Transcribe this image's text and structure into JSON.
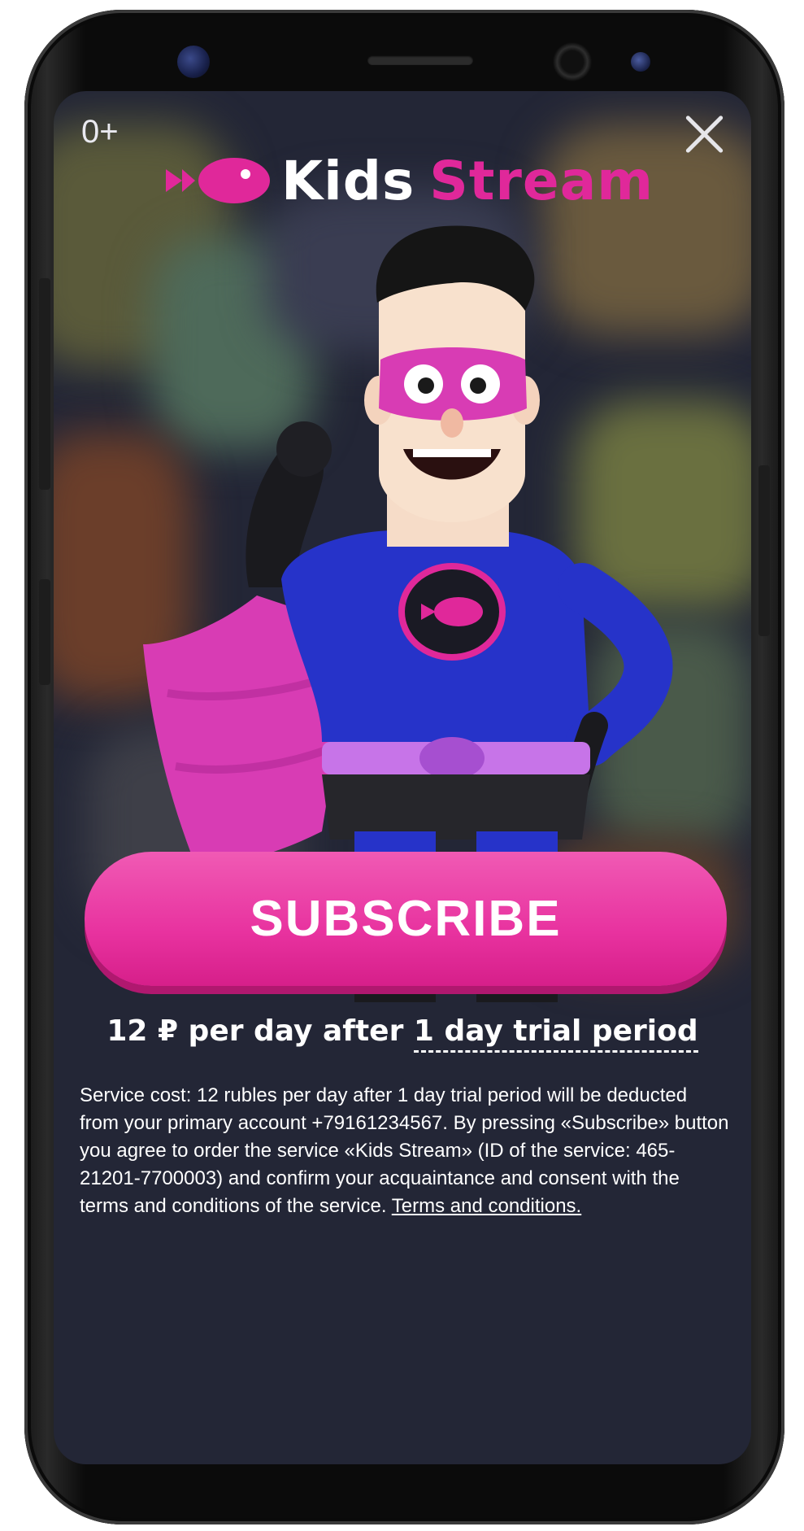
{
  "header": {
    "age_rating": "0+",
    "logo_word1": "Kids",
    "logo_word2": "Stream"
  },
  "cta": {
    "subscribe_label": "SUBSCRIBE",
    "price_prefix": "12 ₽ per day after ",
    "trial_label": "1 day trial period"
  },
  "legal": {
    "text": "Service cost: 12 rubles per day after 1 day trial period will be deducted from your primary account +79161234567. By pressing «Subscribe» button you agree to order the service «Kids Stream» (ID of the service: 465-21201-7700003) and confirm your acquaintance and consent with the terms and conditions of the service. ",
    "terms_link": "Terms and conditions."
  },
  "colors": {
    "accent": "#e8329f",
    "screen_bg": "#232636",
    "hero_suit": "#2633c9"
  },
  "icons": [
    "close-icon",
    "fish-logo-icon",
    "superhero-mascot"
  ]
}
